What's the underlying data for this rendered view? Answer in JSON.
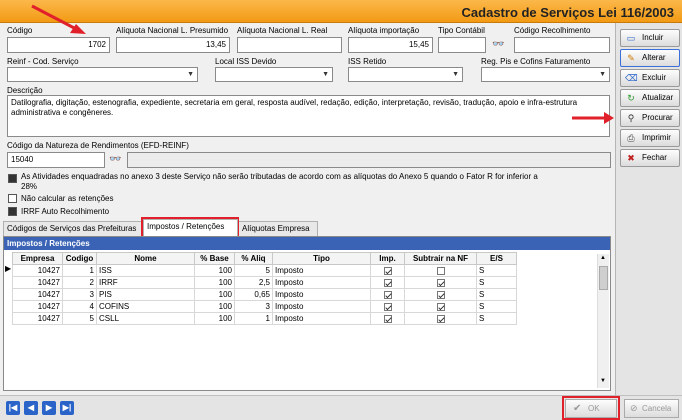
{
  "window": {
    "title": "Cadastro de Serviços Lei 116/2003"
  },
  "form": {
    "codigo": {
      "label": "Código",
      "value": "1702"
    },
    "aliq_presumido": {
      "label": "Alíquota Nacional L. Presumido",
      "value": "13,45"
    },
    "aliq_real": {
      "label": "Alíquota Nacional L. Real",
      "value": ""
    },
    "aliq_importacao": {
      "label": "Alíquota importação",
      "value": "15,45"
    },
    "tipo_contabil": {
      "label": "Tipo Contábil",
      "value": ""
    },
    "codigo_recolhimento": {
      "label": "Código Recolhimento",
      "value": ""
    },
    "reinf_cod_servico": {
      "label": "Reinf - Cod. Serviço",
      "value": ""
    },
    "local_iss": {
      "label": "Local ISS Devido",
      "value": ""
    },
    "iss_retido": {
      "label": "ISS Retido",
      "value": ""
    },
    "reg_pis_cofins": {
      "label": "Reg. Pis e Cofins Faturamento",
      "value": ""
    },
    "descricao": {
      "label": "Descrição",
      "value": "Datilografia, digitação, estenografia, expediente, secretaria em geral, resposta audível, redação, edição, interpretação, revisão, tradução, apoio e infra-estrutura administrativa e congêneres."
    },
    "natureza_rendimentos": {
      "label": "Código da Natureza de Rendimentos (EFD-REINF)",
      "value": "15040",
      "desc": ""
    },
    "chk_anexo3": {
      "label": "As Atividades enquadradas no anexo 3 deste Serviço não serão tributadas de acordo com as alíquotas do Anexo 5 quando o Fator R for inferior a 28%",
      "checked": true
    },
    "chk_nao_calcular": {
      "label": "Não calcular as retenções",
      "checked": false
    },
    "chk_irrf": {
      "label": "IRRF Auto Recolhimento",
      "checked": true
    }
  },
  "sidebar": {
    "incluir": "Incluir",
    "alterar": "Alterar",
    "excluir": "Excluir",
    "atualizar": "Atualizar",
    "procurar": "Procurar",
    "imprimir": "Imprimir",
    "fechar": "Fechar"
  },
  "tabs": [
    "Códigos de Serviços das Prefeituras",
    "Impostos / Retenções",
    "Alíquotas Empresa"
  ],
  "grid": {
    "title": "Impostos / Retenções",
    "columns": [
      "Empresa",
      "Codigo",
      "Nome",
      "% Base",
      "% Aliq",
      "Tipo",
      "Imp.",
      "Subtrair na NF",
      "E/S"
    ],
    "rows": [
      {
        "empresa": "10427",
        "codigo": "1",
        "nome": "ISS",
        "base": "100",
        "aliq": "5",
        "tipo": "Imposto",
        "imp": true,
        "subtrair": false,
        "es": "S"
      },
      {
        "empresa": "10427",
        "codigo": "2",
        "nome": "IRRF",
        "base": "100",
        "aliq": "2,5",
        "tipo": "Imposto",
        "imp": true,
        "subtrair": true,
        "es": "S"
      },
      {
        "empresa": "10427",
        "codigo": "3",
        "nome": "PIS",
        "base": "100",
        "aliq": "0,65",
        "tipo": "Imposto",
        "imp": true,
        "subtrair": true,
        "es": "S"
      },
      {
        "empresa": "10427",
        "codigo": "4",
        "nome": "COFINS",
        "base": "100",
        "aliq": "3",
        "tipo": "Imposto",
        "imp": true,
        "subtrair": true,
        "es": "S"
      },
      {
        "empresa": "10427",
        "codigo": "5",
        "nome": "CSLL",
        "base": "100",
        "aliq": "1",
        "tipo": "Imposto",
        "imp": true,
        "subtrair": true,
        "es": "S"
      }
    ]
  },
  "footer": {
    "ok": "OK",
    "cancela": "Cancela"
  },
  "colors": {
    "title_bar": "#f5a623",
    "grid_header": "#3b63b5",
    "annotation": "#e0202a"
  }
}
